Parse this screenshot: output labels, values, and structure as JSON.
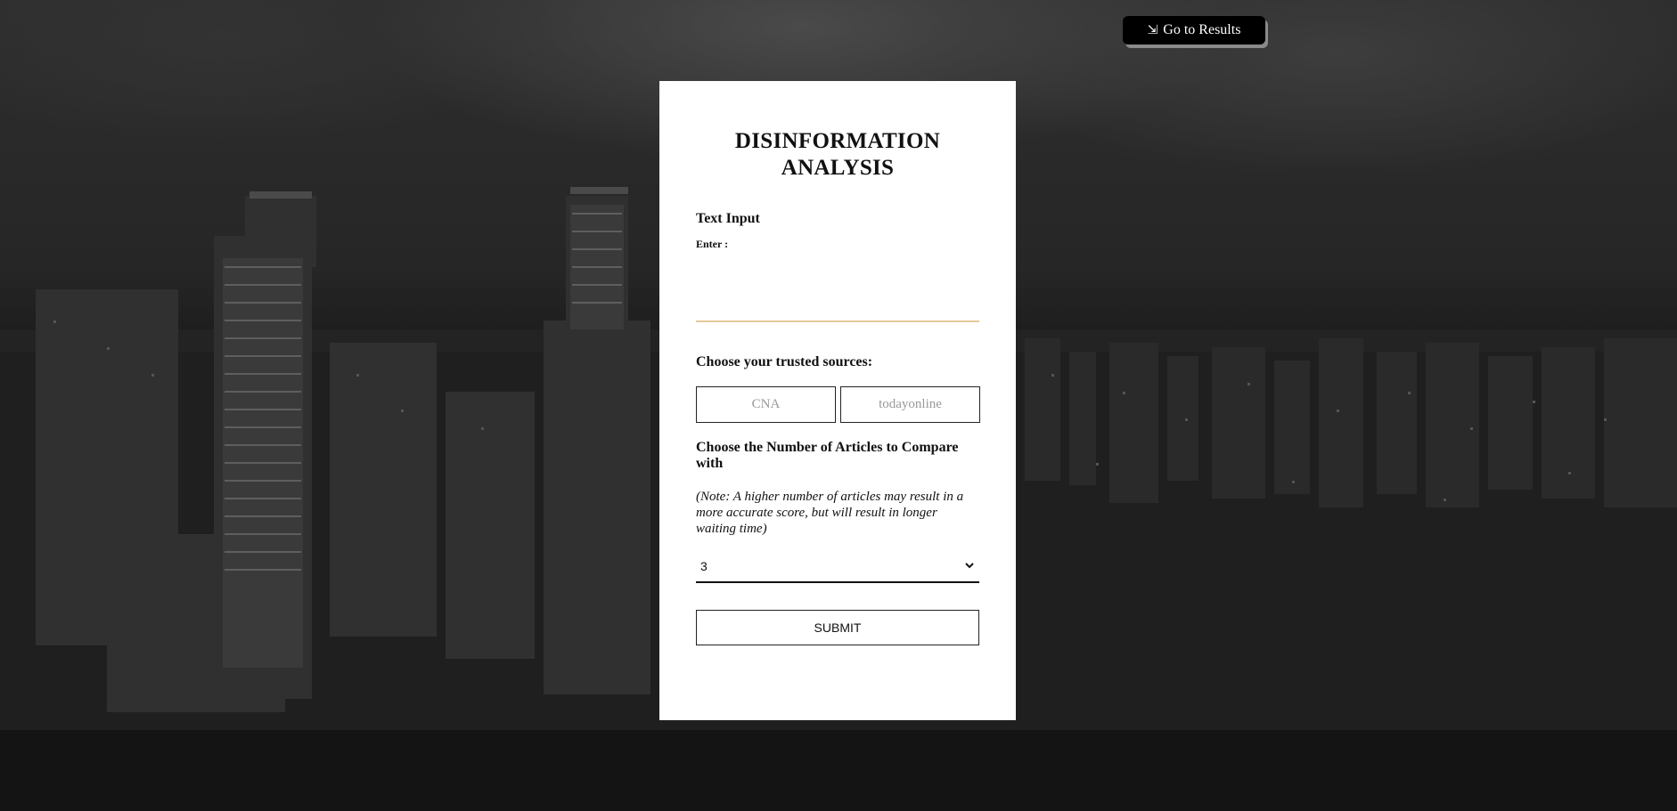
{
  "header": {
    "results_button": {
      "icon": "exit-icon",
      "label": "Go to Results"
    }
  },
  "form": {
    "title": "DISINFORMATION ANALYSIS",
    "text_input": {
      "section_label": "Text Input",
      "field_label": "Enter :",
      "value": ""
    },
    "sources": {
      "section_label": "Choose your trusted sources:",
      "fields": [
        {
          "placeholder": "CNA"
        },
        {
          "placeholder": "todayonline"
        }
      ]
    },
    "articles": {
      "section_label": "Choose the Number of Articles to Compare with",
      "note": "(Note: A higher number of articles may result in a more accurate score, but will result in longer waiting time)",
      "selected_value": "3"
    },
    "submit_label": "SUBMIT"
  },
  "colors": {
    "textarea_underline": "#e3c99a",
    "card_background": "#ffffff",
    "results_button_background": "#000000"
  }
}
